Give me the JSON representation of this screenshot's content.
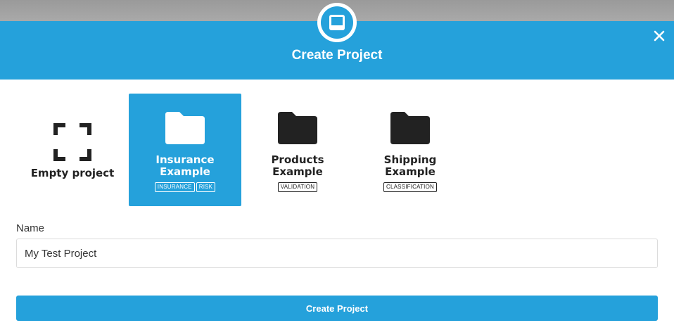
{
  "dialog": {
    "title": "Create Project",
    "header_icon": "inbox-icon",
    "close_icon": "close-icon",
    "accent_color": "#25a1db"
  },
  "templates": [
    {
      "icon": "empty-frame-icon",
      "title_lines": [
        "Empty project"
      ],
      "tags": [],
      "selected": false
    },
    {
      "icon": "folder-icon",
      "title_lines": [
        "Insurance",
        "Example"
      ],
      "tags": [
        "INSURANCE",
        "RISK"
      ],
      "selected": true
    },
    {
      "icon": "folder-icon",
      "title_lines": [
        "Products",
        "Example"
      ],
      "tags": [
        "VALIDATION"
      ],
      "selected": false
    },
    {
      "icon": "folder-icon",
      "title_lines": [
        "Shipping",
        "Example"
      ],
      "tags": [
        "CLASSIFICATION"
      ],
      "selected": false
    }
  ],
  "form": {
    "name_label": "Name",
    "name_value": "My Test Project",
    "submit_label": "Create Project"
  }
}
